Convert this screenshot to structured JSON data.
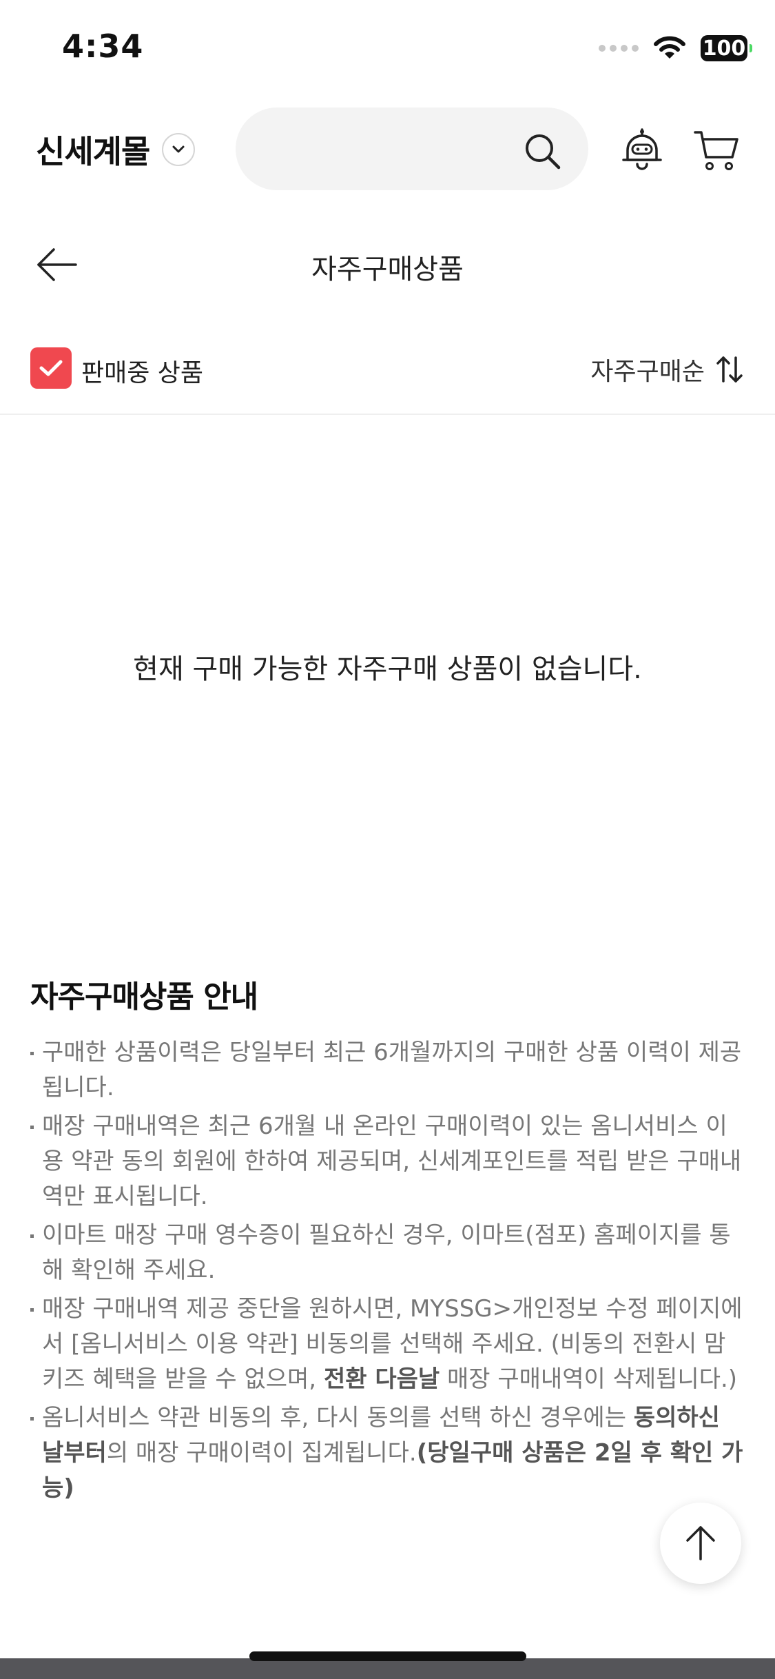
{
  "status_bar": {
    "time": "4:34",
    "battery": "100"
  },
  "header": {
    "brand": "신세계몰"
  },
  "title_bar": {
    "title": "자주구매상품"
  },
  "filter": {
    "checkbox_label": "판매중 상품",
    "sort_label": "자주구매순",
    "checked": true
  },
  "empty_message": "현재 구매 가능한 자주구매 상품이 없습니다.",
  "notice": {
    "title": "자주구매상품 안내",
    "items": [
      "구매한 상품이력은 당일부터 최근 6개월까지의 구매한 상품 이력이 제공됩니다.",
      "매장 구매내역은 최근 6개월 내 온라인 구매이력이 있는 옴니서비스 이용 약관 동의 회원에 한하여 제공되며, 신세계포인트를 적립 받은 구매내역만 표시됩니다.",
      "이마트 매장 구매 영수증이 필요하신 경우, 이마트(점포) 홈페이지를 통해 확인해 주세요."
    ],
    "item4": {
      "text1": "매장 구매내역 제공 중단을 원하시면, MYSSG>개인정보 수정 페이지에서 [옴니서비스 이용 약관] 비동의를 선택해 주세요. (비동의 전환시 맘키즈 혜택을 받을 수 없으며, ",
      "bold": "전환 다음날",
      "text2": " 매장 구매내역이 삭제됩니다.)"
    },
    "item5": {
      "text1": "옴니서비스 약관 비동의 후, 다시 동의를 선택 하신 경우에는 ",
      "bold1": "동의하신 날부터",
      "text2": "의 매장 구매이력이 집계됩니다.",
      "bold2": "(당일구매 상품은 2일 후 확인 가능)"
    }
  },
  "colors": {
    "accent": "#f0484f",
    "text_primary": "#222222",
    "text_secondary": "#777777"
  }
}
